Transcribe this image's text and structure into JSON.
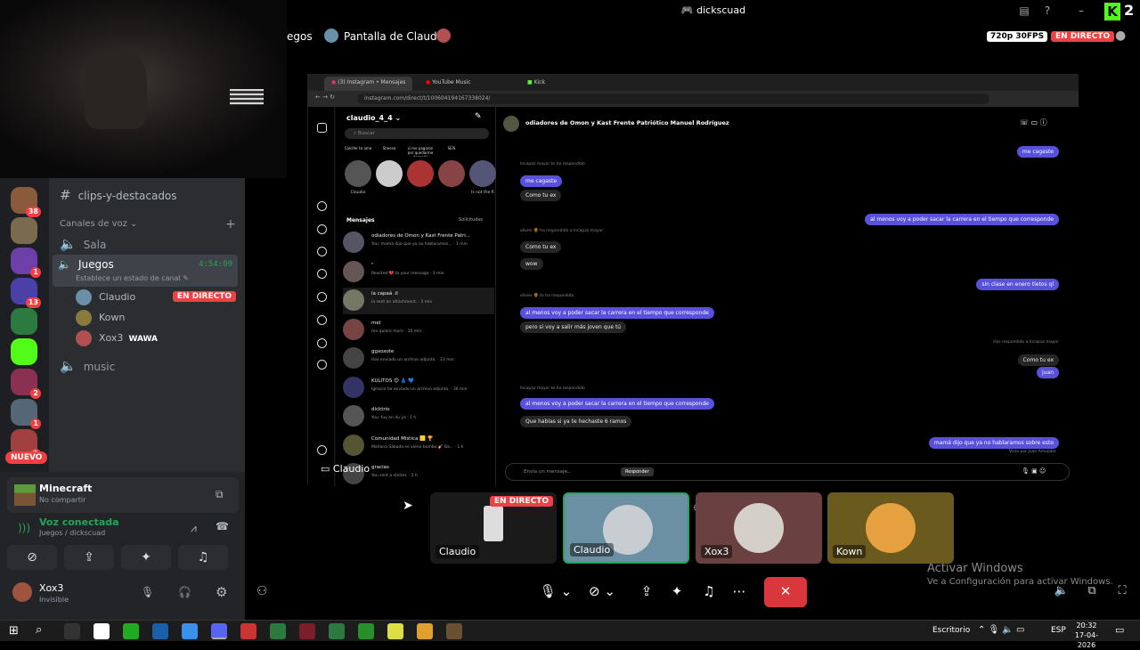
{
  "window": {
    "title": "dickscuad",
    "live_count": "2"
  },
  "stream_header": {
    "crumb": "egos",
    "title": "Pantalla de Claudio",
    "quality": "720p 30FPS",
    "live": "EN DIRECTO"
  },
  "servers": [
    {
      "badge": "38",
      "color": "#8b5a3c"
    },
    {
      "badge": "",
      "color": "#7a6a50"
    },
    {
      "badge": "1",
      "color": "#6d3fa8"
    },
    {
      "badge": "13",
      "color": "#4b3fa8"
    },
    {
      "badge": "",
      "color": "#2c7a3f"
    },
    {
      "badge": "",
      "color": "#53fc18"
    },
    {
      "badge": "2",
      "color": "#8a3050"
    },
    {
      "badge": "1",
      "color": "#556677"
    },
    {
      "badge": "1",
      "color": "#a04040"
    }
  ],
  "new_label": "NUEVO",
  "channels": {
    "text_channel": "clips-y-destacados",
    "voice_category": "Canales de voz",
    "sala": "Sala",
    "juegos": {
      "name": "Juegos",
      "time": "4:54:09",
      "status": "Establece un estado de canal"
    },
    "voice_users": [
      {
        "name": "Claudio",
        "live": "EN DIRECTO",
        "color": "#6a8fa8"
      },
      {
        "name": "Kown",
        "live": "",
        "color": "#8a7a40"
      },
      {
        "name": "Xox3",
        "extra": "WAWA",
        "live": "",
        "color": "#b05050"
      }
    ],
    "music": "music"
  },
  "activity": {
    "game": "Minecraft",
    "sub": "No compartir"
  },
  "voice_connected": {
    "title": "Voz conectada",
    "sub": "Juegos / dickscuad"
  },
  "user": {
    "name": "Xox3",
    "status": "Invisible"
  },
  "browser": {
    "tabs": [
      "(3) Instagram • Mensajes",
      "YouTube Music",
      "Kick"
    ],
    "url": "instagram.com/direct/t/100604194167338024/"
  },
  "instagram": {
    "account": "claudio_4_4",
    "search_placeholder": "Buscar",
    "notes": [
      {
        "note": "Calcifer te amo",
        "name": "Claudio"
      },
      {
        "note": "Sheesa",
        "name": ""
      },
      {
        "note": "si me pagaron por quedarme dormido",
        "name": ""
      },
      {
        "note": "SEIS",
        "name": ""
      },
      {
        "note": "",
        "name": "Is not the R"
      }
    ],
    "messages_label": "Mensajes",
    "requests_label": "Solicitudes",
    "conversations": [
      {
        "name": "odiadores de Omon y Kast Frente Patri...",
        "sub": "You: mamá dijo que ya no hablaramos... · 1 min",
        "color": "#556"
      },
      {
        "name": "\"",
        "sub": "Reacted 💔 to your message · 1 min",
        "color": "#655"
      },
      {
        "name": "la capaа́ .il",
        "sub": "la sent an attachment. · 5 min",
        "color": "#776"
      },
      {
        "name": "mel",
        "sub": "me quiero morir · 16 min",
        "color": "#744"
      },
      {
        "name": "ggxoxote",
        "sub": "Has enviado un archivo adjunto. · 23 min",
        "color": "#444"
      },
      {
        "name": "KULITOS 😊 👗 💙",
        "sub": "Ignacio ha enviado un archivo adjunto. · 36 min",
        "color": "#336"
      },
      {
        "name": "dicktrio",
        "sub": "You: fuy en du yo · 1 h",
        "color": "#555"
      },
      {
        "name": "Comunidad Mistica 🟨 🏆",
        "sub": "Mañana Sábado se viene bombo 🎸 Ba... · 1 h",
        "color": "#553"
      },
      {
        "name": "gracias",
        "sub": "You sent a sticker. · 2 h",
        "color": "#444"
      }
    ],
    "chat_title": "odiadores de Omon y Kast Frente Patriótico Manuel Rodríguez",
    "bubbles": [
      {
        "text": "me cagaste",
        "side": "right",
        "blue": true
      },
      {
        "text": "Incapaz mayor te ha respondido",
        "side": "meta"
      },
      {
        "text": "me cagaste",
        "side": "left",
        "blue": true
      },
      {
        "text": "Como tu ex",
        "side": "left",
        "blue": false
      },
      {
        "text": "al menos voy a poder sacar la carrera en el tiempo que corresponde",
        "side": "right",
        "blue": true
      },
      {
        "text": "olivier 🌻 ha respondido a Incapaz mayor",
        "side": "meta"
      },
      {
        "text": "Como tu ex",
        "side": "left",
        "blue": false
      },
      {
        "text": "wow",
        "side": "left",
        "blue": false
      },
      {
        "text": "sin clase en enero tletos ql",
        "side": "right",
        "blue": true
      },
      {
        "text": "olivier 🌻 te ha respondido",
        "side": "meta"
      },
      {
        "text": "al menos voy a poder sacar la carrera en el tiempo que corresponde",
        "side": "left",
        "blue": true
      },
      {
        "text": "pero si voy a salir más joven que tú",
        "side": "left",
        "blue": false
      },
      {
        "text": "Has respondido a Incapaz mayor",
        "side": "meta-right"
      },
      {
        "text": "Como tu ex",
        "side": "right",
        "blue": false
      },
      {
        "text": "juan",
        "side": "right",
        "blue": true
      },
      {
        "text": "Incapaz mayor te ha respondido",
        "side": "meta"
      },
      {
        "text": "al menos voy a poder sacar la carrera en el tiempo que corresponde",
        "side": "left",
        "blue": true
      },
      {
        "text": "Que hablas si ya te hechaste 6 ramos",
        "side": "left",
        "blue": false
      },
      {
        "text": "mamá dijo que ya no hablaramos sobre esto",
        "side": "right",
        "blue": true
      }
    ],
    "tooltip": "Responder",
    "seen": "Visto por Juan Amojabe",
    "input_placeholder": "Envía un mensaje..."
  },
  "overlay_label": "Claudio",
  "tiles": [
    {
      "name": "Claudio",
      "live": "EN DIRECTO",
      "bg": "#1a1a1a"
    },
    {
      "name": "Claudio",
      "live": "",
      "bg": "#6b8fa3"
    },
    {
      "name": "Xox3",
      "live": "",
      "bg": "#6a4040"
    },
    {
      "name": "Kown",
      "live": "",
      "bg": "#6b5a1e"
    }
  ],
  "windows_watermark": {
    "title": "Activar Windows",
    "sub": "Ve a Configuración para activar Windows."
  },
  "taskbar": {
    "desktop": "Escritorio",
    "lang": "ESP",
    "time": "20:32",
    "date": "17-04-2026"
  }
}
